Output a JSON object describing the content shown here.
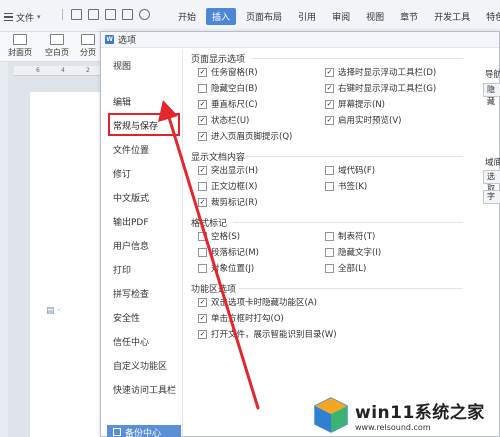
{
  "ribbon": {
    "file_label": "文件",
    "tabs": [
      {
        "label": "开始"
      },
      {
        "label": "插入"
      },
      {
        "label": "页面布局"
      },
      {
        "label": "引用"
      },
      {
        "label": "审阅"
      },
      {
        "label": "视图"
      },
      {
        "label": "章节"
      },
      {
        "label": "开发工具"
      },
      {
        "label": "特色功能"
      }
    ],
    "active_tab": "插入",
    "buttons": [
      {
        "label": "封面页"
      },
      {
        "label": "空白页"
      },
      {
        "label": "分页"
      }
    ]
  },
  "ruler": {
    "marks": [
      "6",
      "4",
      "2"
    ]
  },
  "dialog": {
    "title": "选项",
    "nav": [
      {
        "label": "视图"
      },
      {
        "label": "编辑"
      },
      {
        "label": "常规与保存"
      },
      {
        "label": "文件位置"
      },
      {
        "label": "修订"
      },
      {
        "label": "中文版式"
      },
      {
        "label": "输出PDF"
      },
      {
        "label": "用户信息"
      },
      {
        "label": "打印"
      },
      {
        "label": "拼写检查"
      },
      {
        "label": "安全性"
      },
      {
        "label": "信任中心"
      },
      {
        "label": "自定义功能区"
      },
      {
        "label": "快速访问工具栏"
      }
    ],
    "highlighted_nav": "常规与保存",
    "backup_label": "备份中心",
    "sections": {
      "page_display": {
        "title": "页面显示选项",
        "options": [
          {
            "label": "任务窗格(R)",
            "checked": true
          },
          {
            "label": "隐藏空白(B)",
            "checked": false
          },
          {
            "label": "垂直标尺(C)",
            "checked": true
          },
          {
            "label": "状态栏(U)",
            "checked": true
          },
          {
            "label": "进入页眉页脚提示(Q)",
            "checked": true
          },
          {
            "label": "选择时显示浮动工具栏(D)",
            "checked": true
          },
          {
            "label": "右键时显示浮动工具栏(G)",
            "checked": true
          },
          {
            "label": "屏幕提示(N)",
            "checked": true
          },
          {
            "label": "启用实时预览(V)",
            "checked": true
          }
        ]
      },
      "doc_content": {
        "title": "显示文档内容",
        "options": [
          {
            "label": "突出显示(H)",
            "checked": true
          },
          {
            "label": "正文边框(X)",
            "checked": false
          },
          {
            "label": "裁剪标记(R)",
            "checked": true
          },
          {
            "label": "域代码(F)",
            "checked": false
          },
          {
            "label": "书签(K)",
            "checked": false
          }
        ]
      },
      "format_marks": {
        "title": "格式标记",
        "options": [
          {
            "label": "空格(S)",
            "checked": false
          },
          {
            "label": "段落标记(M)",
            "checked": false
          },
          {
            "label": "对象位置(J)",
            "checked": false
          },
          {
            "label": "制表符(T)",
            "checked": false
          },
          {
            "label": "隐藏文字(I)",
            "checked": false
          },
          {
            "label": "全部(L)",
            "checked": false
          }
        ]
      },
      "ribbon_options": {
        "title": "功能区选项",
        "options": [
          {
            "label": "双击选项卡时隐藏功能区(A)",
            "checked": true
          },
          {
            "label": "单击方框时打勾(O)",
            "checked": true
          },
          {
            "label": "打开文件，展示智能识别目录(W)",
            "checked": true
          }
        ]
      }
    },
    "right_stubs": {
      "nav_label": "导航",
      "nav_select": "隐藏",
      "field_shade_label": "域底",
      "field_select": "选取",
      "font_btn": "字"
    }
  },
  "watermark": {
    "title": "win11系统之家",
    "url": "www.relsound.com"
  },
  "colors": {
    "accent": "#4e87d6",
    "highlight_red": "#e0232b",
    "arrow_red": "#e4262d"
  }
}
